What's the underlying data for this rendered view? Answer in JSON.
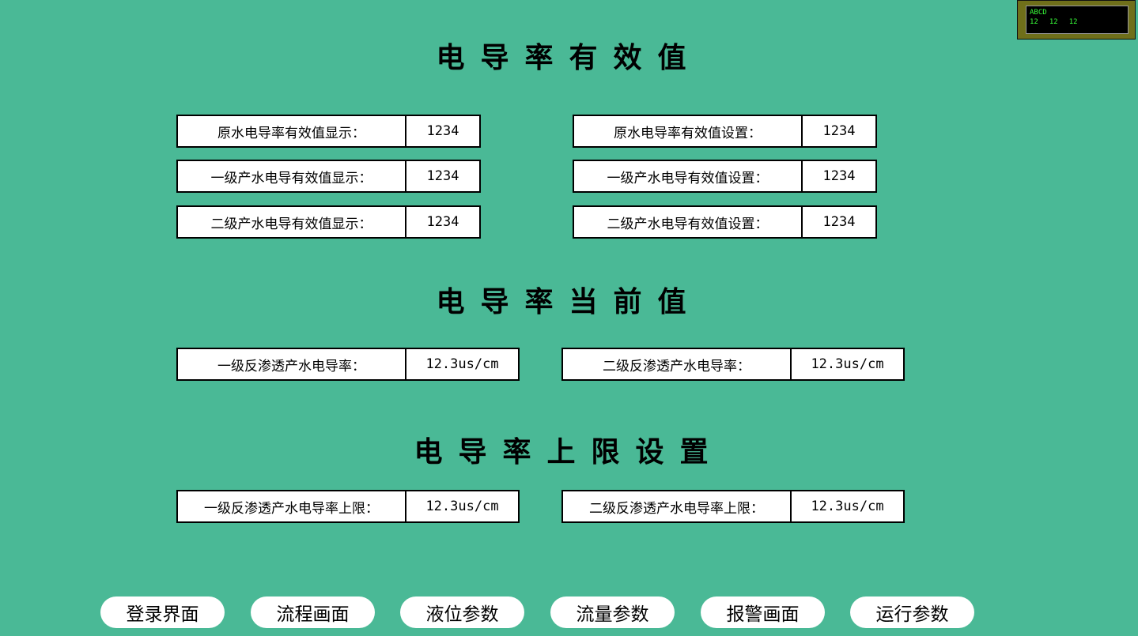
{
  "status": {
    "line1": "ABCD",
    "line2": [
      "12",
      "12",
      "12"
    ]
  },
  "sections": {
    "effective": {
      "title": "电导率有效值",
      "fields": [
        {
          "label": "原水电导率有效值显示：",
          "value": "1234"
        },
        {
          "label": "一级产水电导有效值显示：",
          "value": "1234"
        },
        {
          "label": "二级产水电导有效值显示：",
          "value": "1234"
        },
        {
          "label": "原水电导率有效值设置：",
          "value": "1234"
        },
        {
          "label": "一级产水电导有效值设置：",
          "value": "1234"
        },
        {
          "label": "二级产水电导有效值设置：",
          "value": "1234"
        }
      ]
    },
    "current": {
      "title": "电导率当前值",
      "fields": [
        {
          "label": "一级反渗透产水电导率：",
          "value": "12.3us/cm"
        },
        {
          "label": "二级反渗透产水电导率：",
          "value": "12.3us/cm"
        }
      ]
    },
    "limit": {
      "title": "电导率上限设置",
      "fields": [
        {
          "label": "一级反渗透产水电导率上限：",
          "value": "12.3us/cm"
        },
        {
          "label": "二级反渗透产水电导率上限：",
          "value": "12.3us/cm"
        }
      ]
    }
  },
  "nav": [
    "登录界面",
    "流程画面",
    "液位参数",
    "流量参数",
    "报警画面",
    "运行参数"
  ],
  "colors": {
    "background": "#4ab996",
    "field_bg": "#ffffff",
    "status_text": "#39ff39"
  }
}
